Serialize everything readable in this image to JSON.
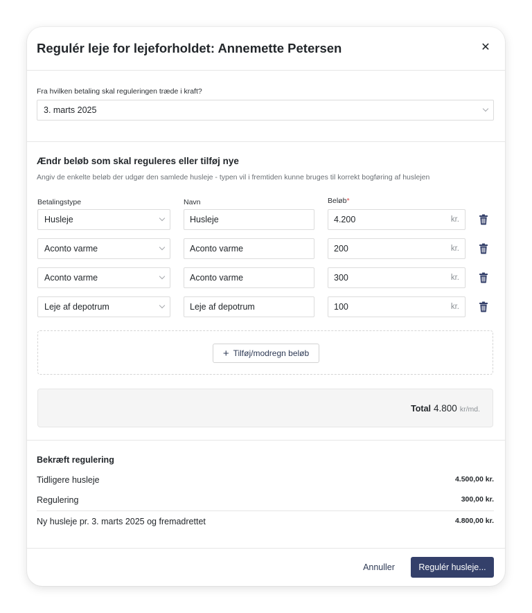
{
  "dialog": {
    "title": "Regulér leje for lejeforholdet: Annemette Petersen",
    "close_glyph": "✕"
  },
  "effective_date": {
    "label": "Fra hvilken betaling skal reguleringen træde i kraft?",
    "value": "3. marts 2025"
  },
  "amounts": {
    "heading": "Ændr beløb som skal reguleres eller tilføj nye",
    "description": "Angiv de enkelte beløb der udgør den samlede husleje - typen vil i fremtiden kunne bruges til korrekt bogføring af huslejen",
    "columns": {
      "type": "Betalingstype",
      "name": "Navn",
      "amount": "Beløb",
      "required_mark": "*"
    },
    "currency_suffix": "kr.",
    "rows": [
      {
        "type": "Husleje",
        "name": "Husleje",
        "amount": "4.200"
      },
      {
        "type": "Aconto varme",
        "name": "Aconto varme",
        "amount": "200"
      },
      {
        "type": "Aconto varme",
        "name": "Aconto varme",
        "amount": "300"
      },
      {
        "type": "Leje af depotrum",
        "name": "Leje af depotrum",
        "amount": "100"
      }
    ],
    "add_button": "Tilføj/modregn beløb",
    "total": {
      "label": "Total",
      "value": "4.800",
      "unit": "kr/md."
    }
  },
  "confirm": {
    "heading": "Bekræft regulering",
    "rows": [
      {
        "label": "Tidligere husleje",
        "value": "4.500,00 kr."
      },
      {
        "label": "Regulering",
        "value": "300,00 kr."
      },
      {
        "label": "Ny husleje pr. 3. marts 2025 og fremadrettet",
        "value": "4.800,00 kr."
      }
    ]
  },
  "footer": {
    "cancel": "Annuller",
    "submit": "Regulér husleje..."
  },
  "icons": {
    "close": "close-icon",
    "chevron": "chevron-down-icon",
    "delete": "trash-icon",
    "add": "plus-icon"
  },
  "colors": {
    "primary": "#34406a",
    "required": "#d64545",
    "accent_text": "#2e3a55"
  }
}
